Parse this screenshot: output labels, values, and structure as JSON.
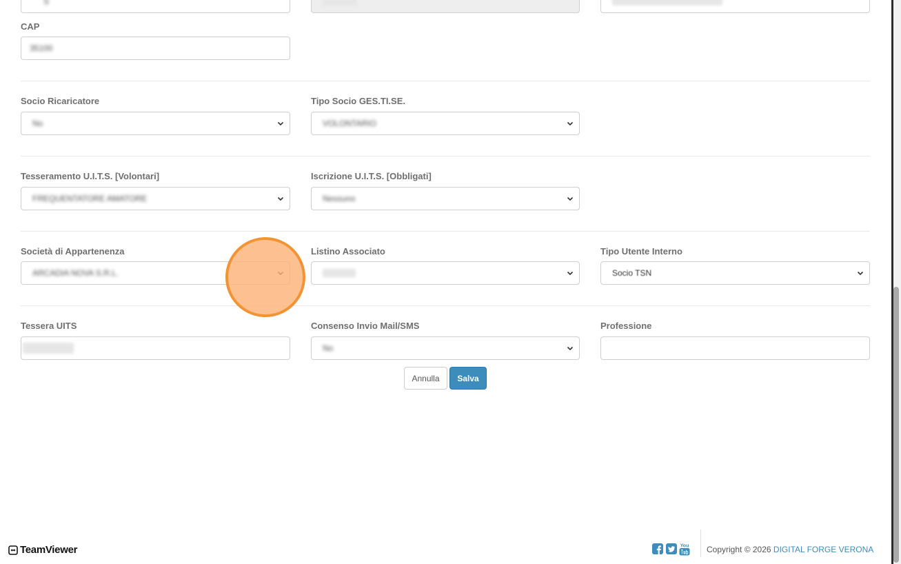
{
  "form": {
    "row0": {
      "field1_value": "S",
      "field2_value": "",
      "field3_value": ""
    },
    "cap": {
      "label": "CAP",
      "value": "35100"
    },
    "socio_ricaricatore": {
      "label": "Socio Ricaricatore",
      "value": "No"
    },
    "tipo_socio": {
      "label": "Tipo Socio GES.TI.SE.",
      "value": "VOLONTARIO"
    },
    "tesseramento": {
      "label": "Tesseramento U.I.T.S. [Volontari]",
      "value": "FREQUENTATORE AMATORE"
    },
    "iscrizione": {
      "label": "Iscrizione U.I.T.S. [Obbligati]",
      "value": "Nessuno"
    },
    "societa": {
      "label": "Società di Appartenenza",
      "value": "ARCADIA NOVA S.R.L."
    },
    "listino": {
      "label": "Listino Associato",
      "value": ""
    },
    "tipo_utente": {
      "label": "Tipo Utente Interno",
      "value": "Socio TSN"
    },
    "tessera_uits": {
      "label": "Tessera UITS",
      "value": ""
    },
    "consenso": {
      "label": "Consenso Invio Mail/SMS",
      "value": "No"
    },
    "professione": {
      "label": "Professione",
      "value": ""
    }
  },
  "buttons": {
    "cancel": "Annulla",
    "save": "Salva"
  },
  "footer": {
    "copyright_prefix": "Copyright © 2026 ",
    "brand": "DIGITAL FORGE VERONA",
    "social_icons": [
      "facebook-icon",
      "twitter-icon",
      "youtube-icon"
    ]
  },
  "teamviewer": {
    "label": "TeamViewer"
  },
  "colors": {
    "primary": "#3c8dbc",
    "click_indicator": "#f39434",
    "youtube_text": "You"
  }
}
